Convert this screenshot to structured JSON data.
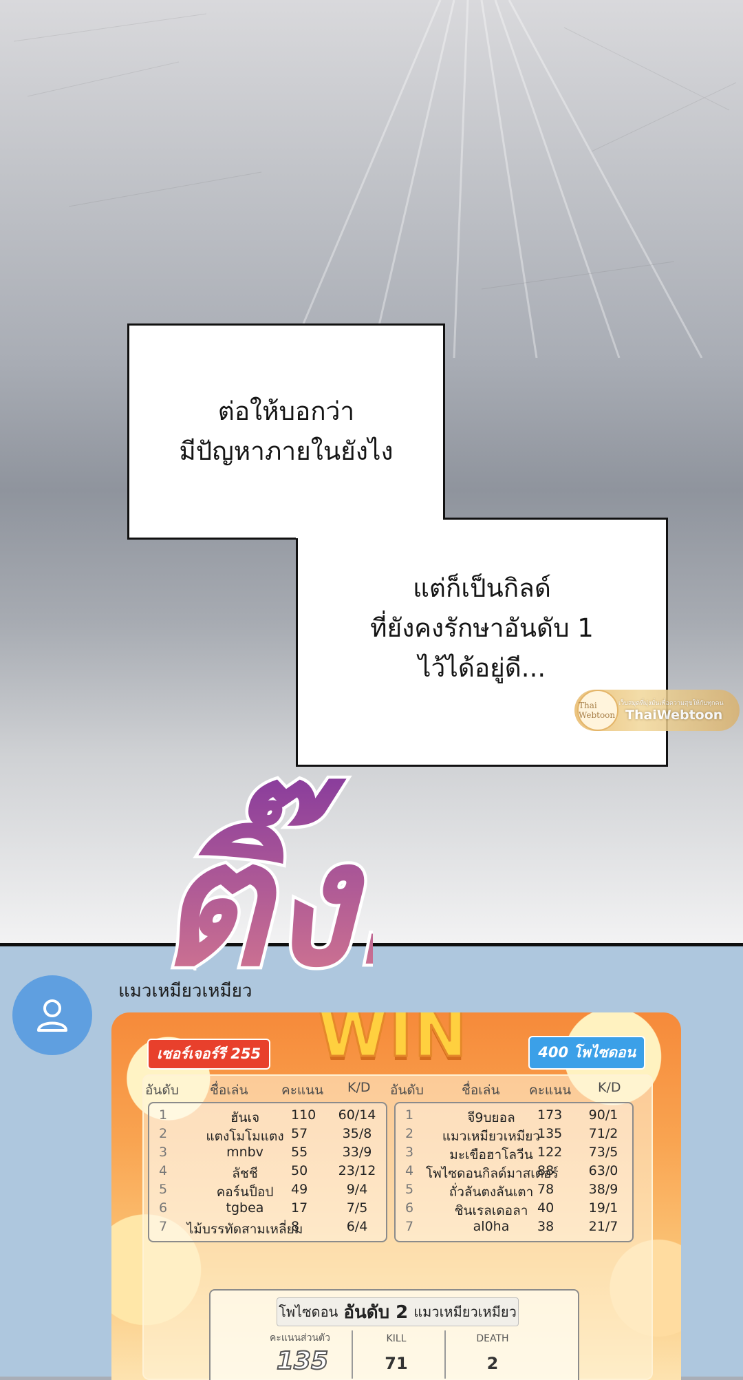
{
  "panel": {
    "caption1": [
      "ต่อให้บอกว่า",
      "มีปัญหาภายในยังไง"
    ],
    "caption2": [
      "แต่ก็เป็นกิลด์",
      "ที่ยังคงรักษาอันดับ 1",
      "ไว้ได้อยู่ดี..."
    ],
    "sfx": "ติ๊ง!",
    "watermark": {
      "logo": "Thai Webtoon",
      "tagline": "เว็บสมุดที่มุ่งมั่นเพื่อความสุขให้กับทุกคน",
      "name": "ThaiWebtoon"
    }
  },
  "chat": {
    "username": "แมวเหมียวเหมียว",
    "avatar_icon": "user-icon"
  },
  "scoreboard": {
    "banner": "WIN",
    "left_team": "เซอร์เจอร์รี 255",
    "right_team": "400 โพไซดอน",
    "headers": [
      "อันดับ",
      "ชื่อเล่น",
      "คะแนน",
      "K/D"
    ],
    "left_rows": [
      [
        "1",
        "ฮันเจ",
        "110",
        "60/14"
      ],
      [
        "2",
        "แตงโมโมแตง",
        "57",
        "35/8"
      ],
      [
        "3",
        "mnbv",
        "55",
        "33/9"
      ],
      [
        "4",
        "ลัชชี",
        "50",
        "23/12"
      ],
      [
        "5",
        "คอร์นป็อป",
        "49",
        "9/4"
      ],
      [
        "6",
        "tgbea",
        "17",
        "7/5"
      ],
      [
        "7",
        "ไม้บรรทัดสามเหลี่ยม",
        "8",
        "6/4"
      ]
    ],
    "right_rows": [
      [
        "1",
        "จี9บยอล",
        "173",
        "90/1"
      ],
      [
        "2",
        "แมวเหมียวเหมียว",
        "135",
        "71/2"
      ],
      [
        "3",
        "มะเขือฮาโลวีน",
        "122",
        "73/5"
      ],
      [
        "4",
        "โพไซดอนกิลด์มาสเตอร์",
        "88",
        "63/0"
      ],
      [
        "5",
        "ถั่วลันตงลันเตา",
        "78",
        "38/9"
      ],
      [
        "6",
        "ชินเรลเดอลา",
        "40",
        "19/1"
      ],
      [
        "7",
        "al0ha",
        "38",
        "21/7"
      ]
    ],
    "summary": {
      "team": "โพไซดอน",
      "rank": "อันดับ 2",
      "player": "แมวเหมียวเหมียว",
      "score_label": "คะแนนส่วนตัว",
      "score": "135",
      "kill_label": "KILL",
      "kill": "71",
      "death_label": "DEATH",
      "death": "2"
    }
  }
}
